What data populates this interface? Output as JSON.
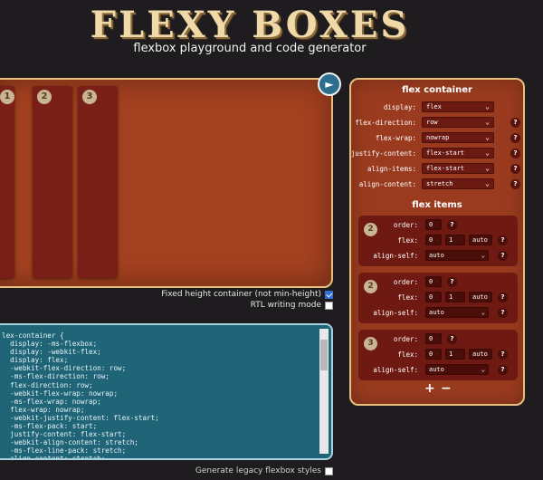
{
  "header": {
    "logo": "FLEXY BOXES",
    "subtitle": "flexbox playground and code generator"
  },
  "playground": {
    "items": [
      "1",
      "2",
      "3"
    ]
  },
  "options": {
    "fixed_height_label": "Fixed height container (not min-height)",
    "fixed_height_checked": true,
    "rtl_label": "RTL writing mode",
    "rtl_checked": false,
    "legacy_label": "Generate legacy flexbox styles",
    "legacy_checked": false
  },
  "code": {
    "text": "lex-container {\n  display: -ms-flexbox;\n  display: -webkit-flex;\n  display: flex;\n  -webkit-flex-direction: row;\n  -ms-flex-direction: row;\n  flex-direction: row;\n  -webkit-flex-wrap: nowrap;\n  -ms-flex-wrap: nowrap;\n  flex-wrap: nowrap;\n  -webkit-justify-content: flex-start;\n  -ms-flex-pack: start;\n  justify-content: flex-start;\n  -webkit-align-content: stretch;\n  -ms-flex-line-pack: stretch;\n  align-content: stretch;"
  },
  "panel": {
    "container_title": "flex container",
    "container_props": [
      {
        "label": "display:",
        "value": "flex"
      },
      {
        "label": "flex-direction:",
        "value": "row"
      },
      {
        "label": "flex-wrap:",
        "value": "nowrap"
      },
      {
        "label": "justify-content:",
        "value": "flex-start"
      },
      {
        "label": "align-items:",
        "value": "flex-start"
      },
      {
        "label": "align-content:",
        "value": "stretch"
      }
    ],
    "items_title": "flex items",
    "items": [
      {
        "num": "2",
        "order_label": "order:",
        "order": "0",
        "flex_label": "flex:",
        "grow": "0",
        "shrink": "1",
        "basis": "auto",
        "align_label": "align-self:",
        "align_self": "auto"
      },
      {
        "num": "2",
        "order_label": "order:",
        "order": "0",
        "flex_label": "flex:",
        "grow": "0",
        "shrink": "1",
        "basis": "auto",
        "align_label": "align-self:",
        "align_self": "auto"
      },
      {
        "num": "3",
        "order_label": "order:",
        "order": "0",
        "flex_label": "flex:",
        "grow": "0",
        "shrink": "1",
        "basis": "auto",
        "align_label": "align-self:",
        "align_self": "auto"
      }
    ],
    "help_glyph": "?",
    "add_label": "+",
    "remove_label": "−"
  },
  "colors": {
    "background": "#1f1c1f",
    "playground": "#a3401f",
    "item": "#7a1f17",
    "code_bg": "#1f6577",
    "accent_border": "#e7c07f"
  }
}
